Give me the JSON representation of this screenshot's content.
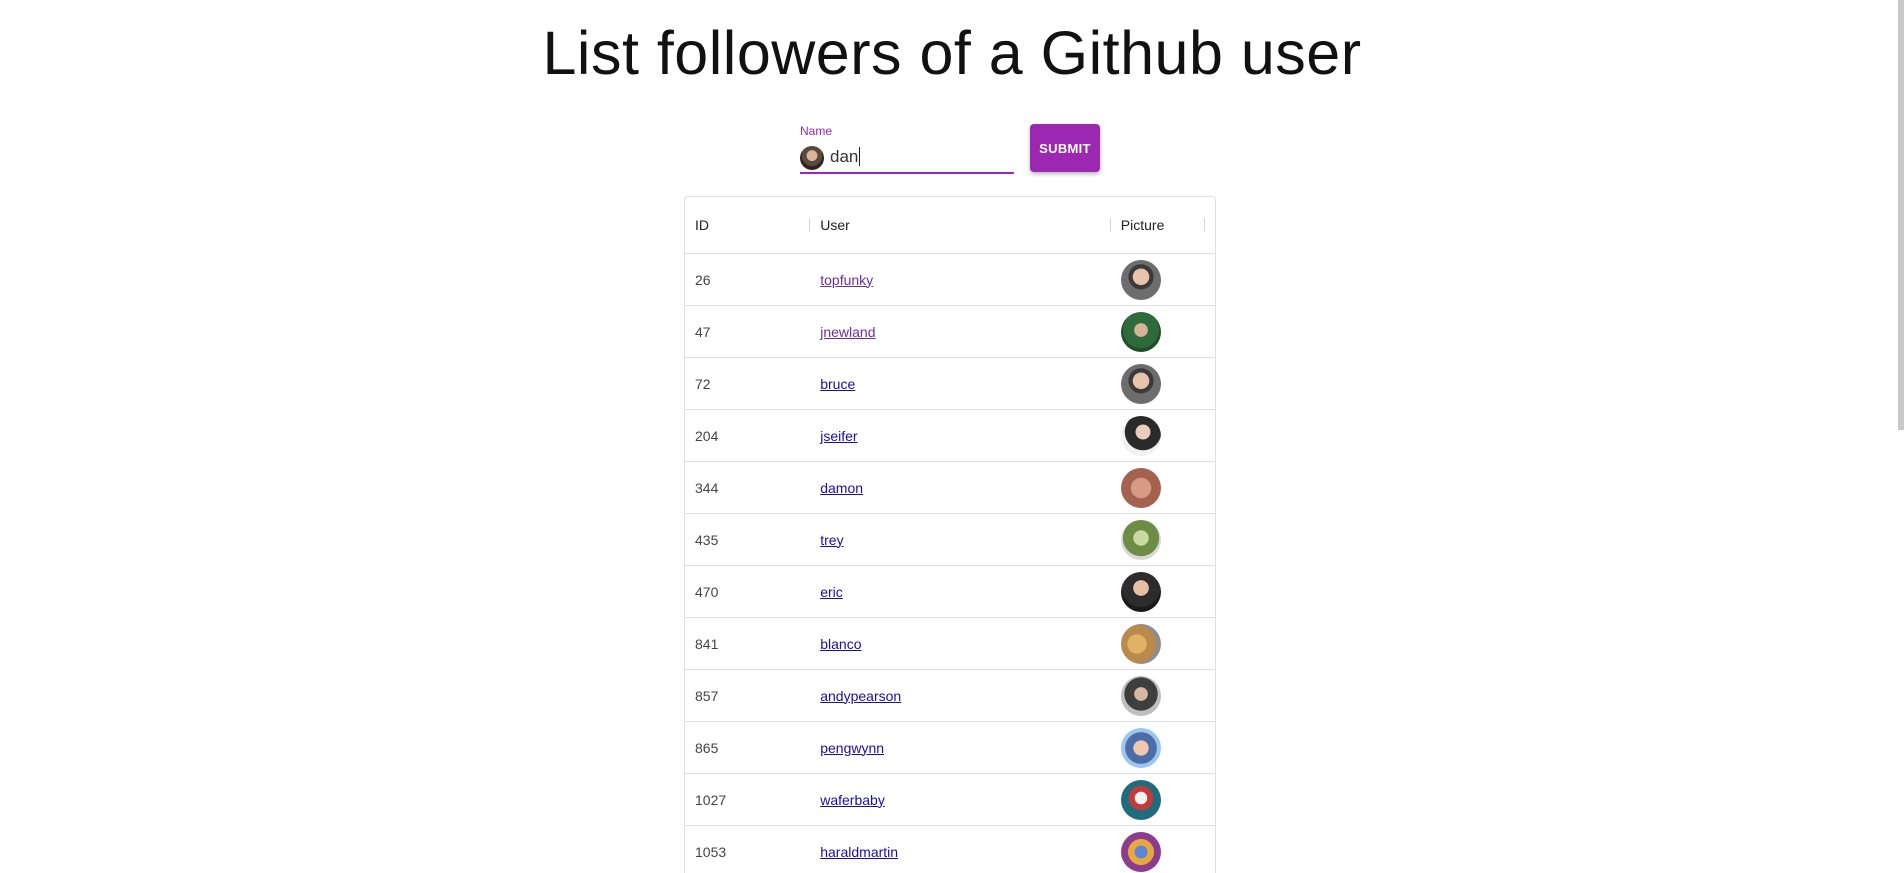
{
  "page": {
    "title": "List followers of a Github user"
  },
  "search": {
    "label": "Name",
    "value": "dan",
    "submit_label": "SUBMIT",
    "accent_color": "#9c27b0"
  },
  "table": {
    "headers": {
      "id": "ID",
      "user": "User",
      "picture": "Picture"
    },
    "rows": [
      {
        "id": "26",
        "user": "topfunky",
        "visited": true,
        "avatar": "avatar-person-glasses"
      },
      {
        "id": "47",
        "user": "jnewland",
        "visited": true,
        "avatar": "avatar-person-outdoors"
      },
      {
        "id": "72",
        "user": "bruce",
        "visited": false,
        "avatar": "avatar-person-glasses"
      },
      {
        "id": "204",
        "user": "jseifer",
        "visited": false,
        "avatar": "avatar-person"
      },
      {
        "id": "344",
        "user": "damon",
        "visited": false,
        "avatar": "avatar-face-closeup"
      },
      {
        "id": "435",
        "user": "trey",
        "visited": false,
        "avatar": "avatar-figurine"
      },
      {
        "id": "470",
        "user": "eric",
        "visited": false,
        "avatar": "avatar-person-suit"
      },
      {
        "id": "841",
        "user": "blanco",
        "visited": false,
        "avatar": "avatar-abstract"
      },
      {
        "id": "857",
        "user": "andypearson",
        "visited": false,
        "avatar": "avatar-person-beard"
      },
      {
        "id": "865",
        "user": "pengwynn",
        "visited": false,
        "avatar": "avatar-person-sky"
      },
      {
        "id": "1027",
        "user": "waferbaby",
        "visited": false,
        "avatar": "avatar-illustration"
      },
      {
        "id": "1053",
        "user": "haraldmartin",
        "visited": false,
        "avatar": "avatar-illustration-colorful"
      }
    ]
  }
}
